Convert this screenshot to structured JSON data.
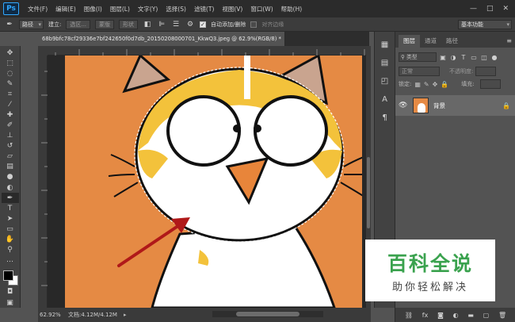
{
  "app": {
    "logo": "Ps",
    "window_controls": [
      "—",
      "□",
      "✕"
    ]
  },
  "menu": [
    "文件(F)",
    "编辑(E)",
    "图像(I)",
    "图层(L)",
    "文字(Y)",
    "选择(S)",
    "滤镜(T)",
    "视图(V)",
    "窗口(W)",
    "帮助(H)"
  ],
  "options_bar": {
    "path_mode": "路径",
    "make_label": "建立:",
    "selection_btn": "选区...",
    "mask_btn": "蒙版",
    "shape_btn": "形状",
    "auto_add_delete": "自动添加/删除",
    "align_edges": "对齐边缘",
    "workspace": "基本功能"
  },
  "document": {
    "tab_title": "68b9bfc78cf29336e7bf242650f0d7db_20150208000701_KkwQ3.jpeg @ 62.9%(RGB/8) *",
    "close": "×"
  },
  "status": {
    "zoom": "62.92%",
    "doc_size": "文档:4.12M/4.12M",
    "arrow": "▸"
  },
  "layers_panel": {
    "tabs": [
      "图层",
      "通道",
      "路径"
    ],
    "menu": "≡",
    "filter_kind": "类型",
    "blend_mode": "正常",
    "opacity_label": "不透明度:",
    "lock_label": "锁定:",
    "fill_label": "填充:",
    "layer_name": "背景"
  },
  "watermark": {
    "title": "百科全说",
    "subtitle": "助你轻松解决"
  },
  "colors": {
    "accent": "#31a8ff",
    "canvas_bg": "#e58a44",
    "watermark_green": "#3aa24e",
    "arrow": "#b01919"
  },
  "icons": {
    "toolbar": [
      "move-icon",
      "marquee-icon",
      "lasso-icon",
      "quick-select-icon",
      "crop-icon",
      "eyedropper-icon",
      "healing-icon",
      "brush-icon",
      "clone-stamp-icon",
      "history-brush-icon",
      "eraser-icon",
      "gradient-icon",
      "blur-icon",
      "dodge-icon",
      "pen-icon",
      "type-icon",
      "path-select-icon",
      "rectangle-icon",
      "hand-icon",
      "zoom-icon",
      "more-tools-icon"
    ]
  }
}
